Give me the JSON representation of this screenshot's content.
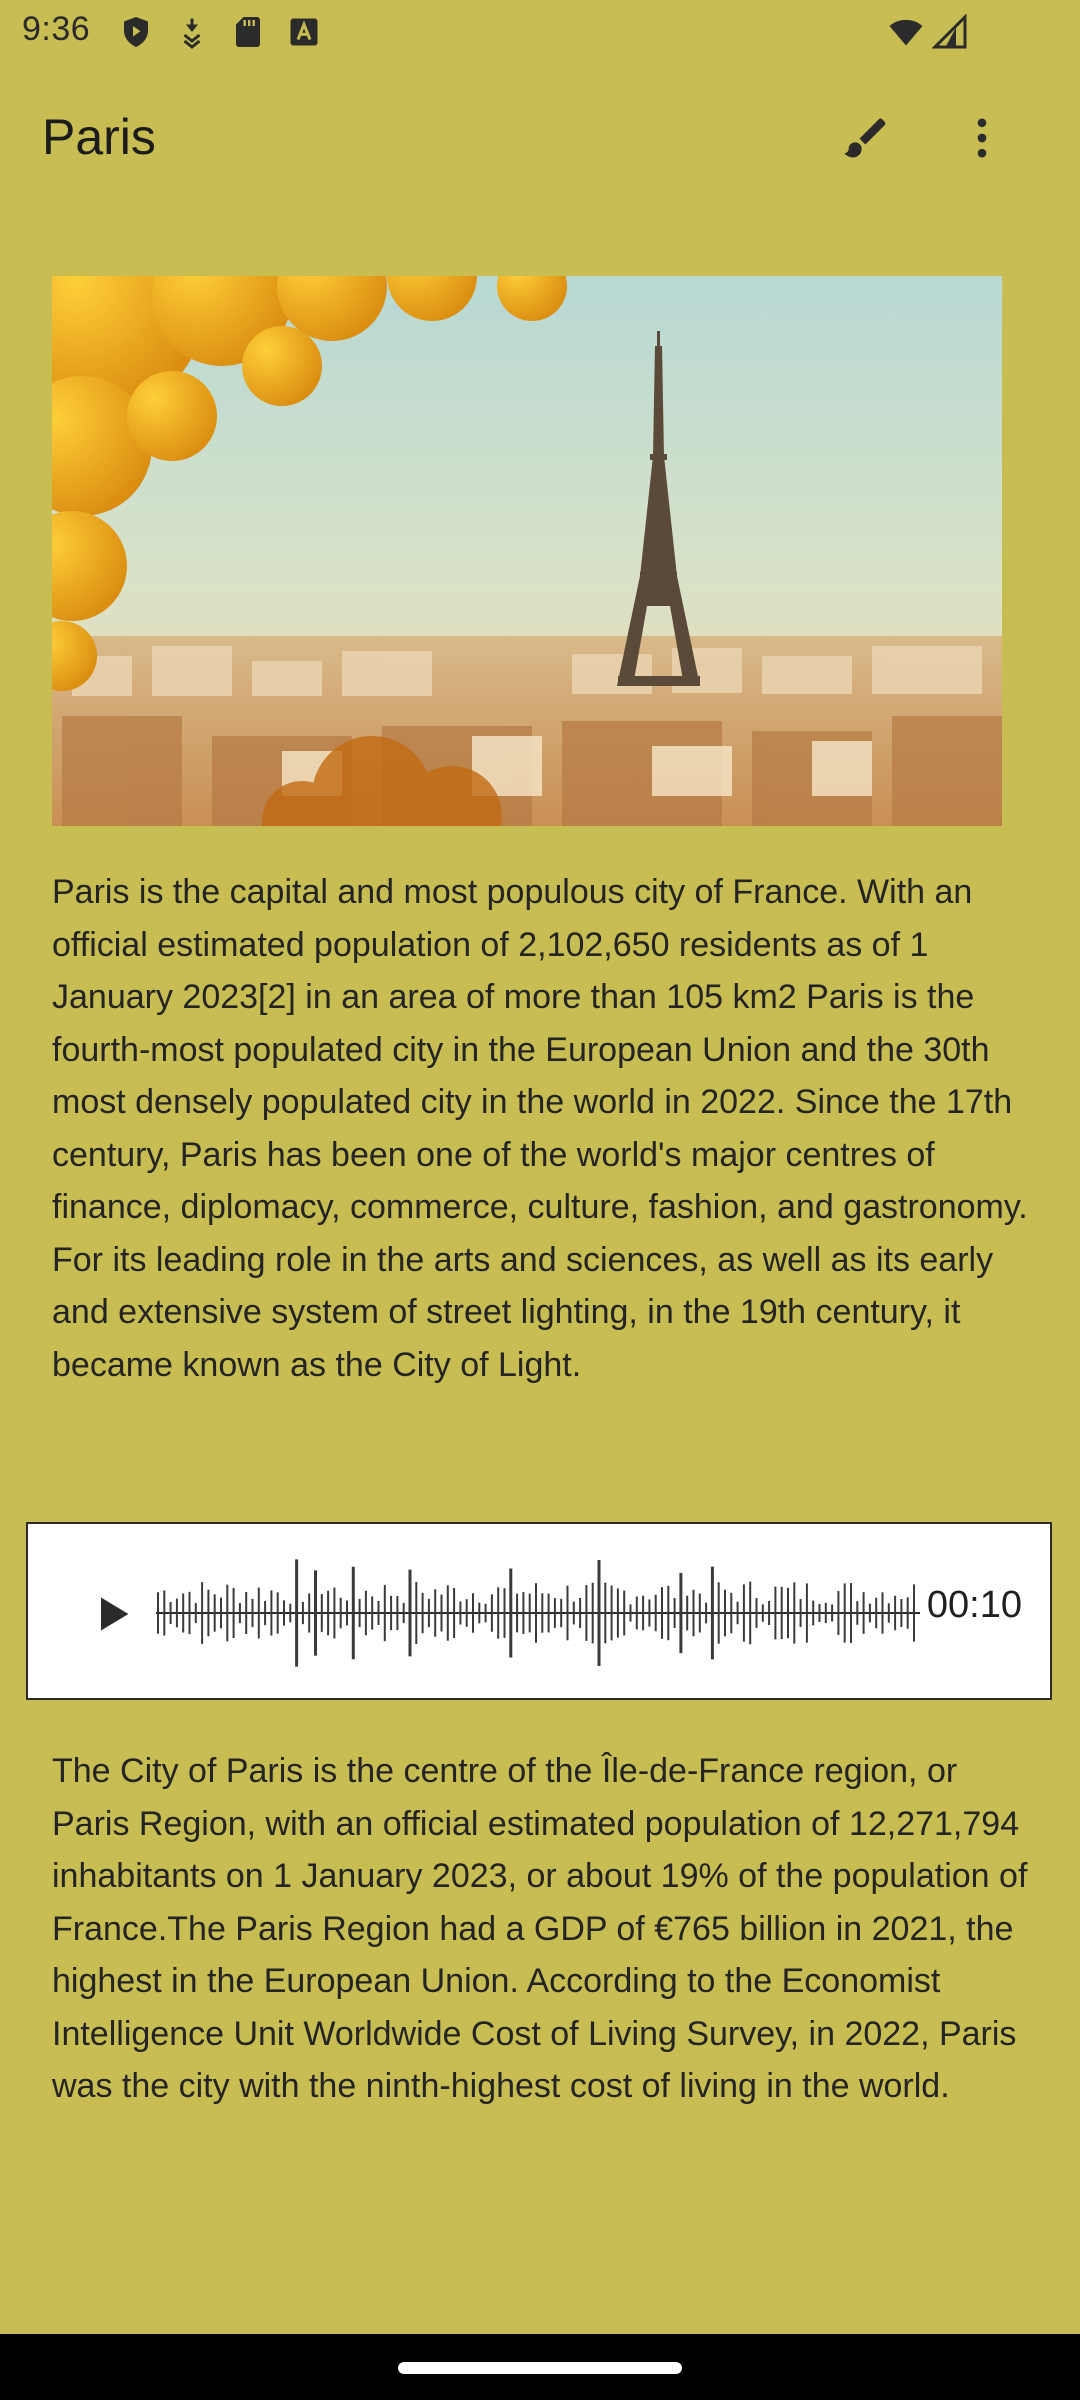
{
  "status_bar": {
    "time": "9:36",
    "left_icons": [
      "shield-icon",
      "download-icon",
      "sd-card-icon",
      "text-a-icon"
    ],
    "right_icons": [
      "wifi-icon",
      "signal-icon"
    ]
  },
  "app_bar": {
    "title": "Paris",
    "actions": [
      "brush-icon",
      "more-vert-icon"
    ]
  },
  "content": {
    "paragraph_1": "Paris is the capital and most populous city of France. With an official estimated population of 2,102,650 residents as of 1 January 2023[2] in an area of more than 105 km2 Paris is the fourth-most populated city in the European Union and the 30th most densely populated city in the world in 2022. Since the 17th century, Paris has been one of the world's major centres of finance, diplomacy, commerce, culture, fashion, and gastronomy. For its leading role in the arts and sciences, as well as its early and extensive system of street lighting, in the 19th century, it became known as the City of Light.",
    "paragraph_2": "The City of Paris is the centre of the Île-de-France region, or Paris Region, with an official estimated population of 12,271,794 inhabitants on 1 January 2023, or about 19% of the population of France.The Paris Region had a GDP of €765 billion in 2021, the highest in the European Union. According to the Economist Intelligence Unit Worldwide Cost of Living Survey, in 2022, Paris was the city with the ninth-highest cost of living in the world."
  },
  "audio_player": {
    "duration": "00:10",
    "play_icon": "play-icon"
  },
  "colors": {
    "background": "#c8bd52",
    "player_background": "#ffffff",
    "nav_bar": "#000000"
  }
}
